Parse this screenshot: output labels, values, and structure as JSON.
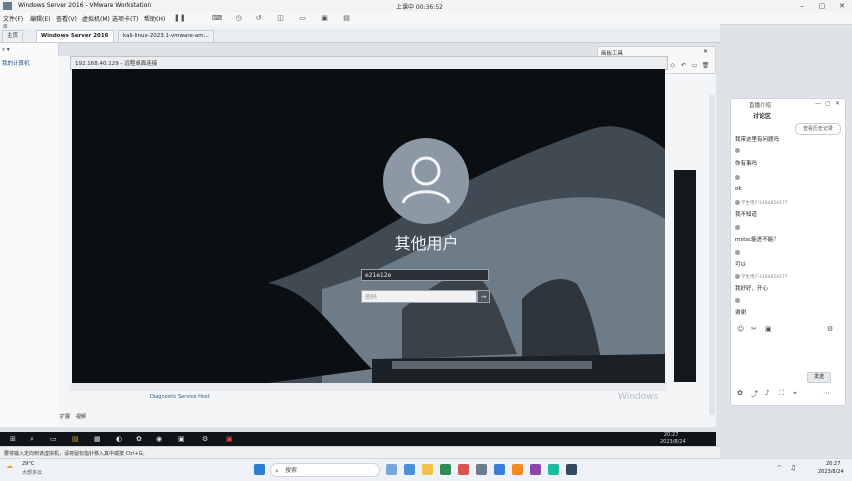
{
  "vmware": {
    "title": "Windows Server 2016 - VMware Workstation",
    "recording_status": "上课中 00:36:52",
    "menu": [
      "文件(F)",
      "编辑(E)",
      "查看(V)",
      "虚拟机(M)",
      "选项卡(T)",
      "帮助(H)"
    ],
    "tabs": [
      "主页",
      "Windows Server 2016",
      "kali-linux-2023.1-vmware-am..."
    ],
    "library_label": "库",
    "library_item": "我的计算机",
    "statusbar_hint": "要将输入定向到该虚拟机，请将鼠标指针移入其中或按 Ctrl+G。",
    "bottom_tabs": [
      "扩展",
      "视频"
    ]
  },
  "remote_desktop": {
    "title": "192.168.40.129 - 远程桌面连接",
    "lock_screen": {
      "user_label": "其他用户",
      "username_value": "e21e12e",
      "password_placeholder": "密码",
      "submit_glyph": "→"
    },
    "inner_list_item": "Diagnostic Service Host"
  },
  "annotation_toolbar": {
    "title": "画板工具",
    "tools": [
      "pointer-icon",
      "pen-icon",
      "marker-icon",
      "line-icon",
      "rectangle-icon",
      "text-icon",
      "eraser-icon",
      "undo-icon",
      "screen-icon",
      "delete-icon"
    ]
  },
  "chat_panel": {
    "header_label": "直播介绍",
    "title": "讨论区",
    "history_button": "查看历史记录",
    "messages": [
      {
        "user": "",
        "text": "我带这里有问题吗"
      },
      {
        "user": "",
        "text": "你有事吗"
      },
      {
        "user": "",
        "text": "也就是你看着我"
      },
      {
        "user": "",
        "text": "ok"
      },
      {
        "user": "学生用户1464854177",
        "text": "我不知道"
      },
      {
        "user": "",
        "text": "mstsc能进不能？"
      },
      {
        "user": "",
        "text": "可以"
      },
      {
        "user": "学生用户1464854177",
        "text": "我好好，开心"
      },
      {
        "user": "",
        "text": "谢谢"
      }
    ],
    "send_button": "发送"
  },
  "windows_taskbar": {
    "weather_temp": "29°C",
    "weather_desc": "大部多云",
    "search_placeholder": "搜索",
    "time": "20:27",
    "date": "2023/8/24",
    "vm_clock_time": "20:27",
    "vm_clock_date": "2023/8/24"
  },
  "watermark": "Windows"
}
